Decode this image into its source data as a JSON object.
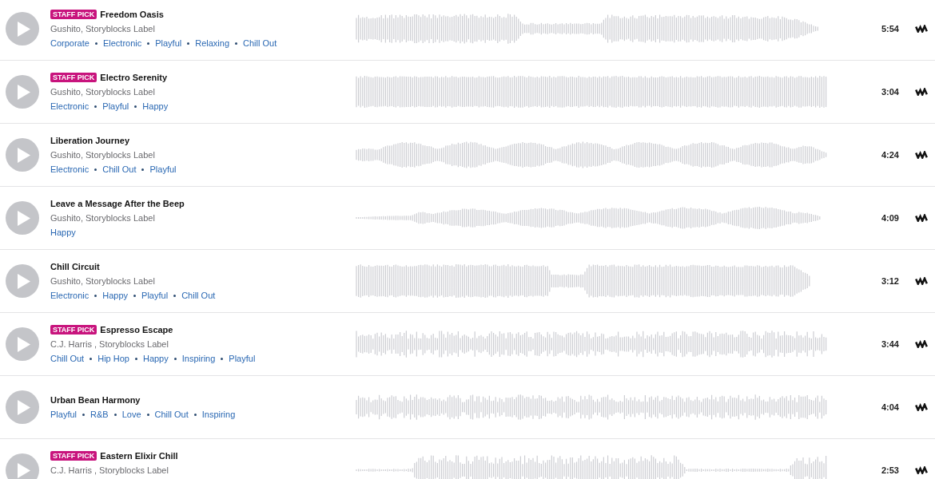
{
  "tracks": [
    {
      "badge": "STAFF PICK",
      "title": "Freedom Oasis",
      "artist": "Gushito, Storyblocks Label",
      "tags": [
        "Corporate",
        "Electronic",
        "Playful",
        "Relaxing",
        "Chill Out"
      ],
      "duration": "5:54"
    },
    {
      "badge": "STAFF PICK",
      "title": "Electro Serenity",
      "artist": "Gushito, Storyblocks Label",
      "tags": [
        "Electronic",
        "Playful",
        "Happy"
      ],
      "duration": "3:04"
    },
    {
      "title": "Liberation Journey",
      "artist": "Gushito, Storyblocks Label",
      "tags": [
        "Electronic",
        "Chill Out",
        "Playful"
      ],
      "duration": "4:24"
    },
    {
      "title": "Leave a Message After the Beep",
      "artist": "Gushito, Storyblocks Label",
      "tags": [
        "Happy"
      ],
      "duration": "4:09"
    },
    {
      "title": "Chill Circuit",
      "artist": "Gushito, Storyblocks Label",
      "tags": [
        "Electronic",
        "Happy",
        "Playful",
        "Chill Out"
      ],
      "duration": "3:12"
    },
    {
      "badge": "STAFF PICK",
      "title": "Espresso Escape",
      "artist": "C.J. Harris , Storyblocks Label",
      "tags": [
        "Chill Out",
        "Hip Hop",
        "Happy",
        "Inspiring",
        "Playful"
      ],
      "duration": "3:44"
    },
    {
      "title": "Urban Bean Harmony",
      "tags": [
        "Playful",
        "R&B",
        "Love",
        "Chill Out",
        "Inspiring"
      ],
      "duration": "4:04"
    },
    {
      "badge": "STAFF PICK",
      "title": "Eastern Elixir Chill",
      "artist": "C.J. Harris , Storyblocks Label",
      "duration": "2:53"
    }
  ]
}
